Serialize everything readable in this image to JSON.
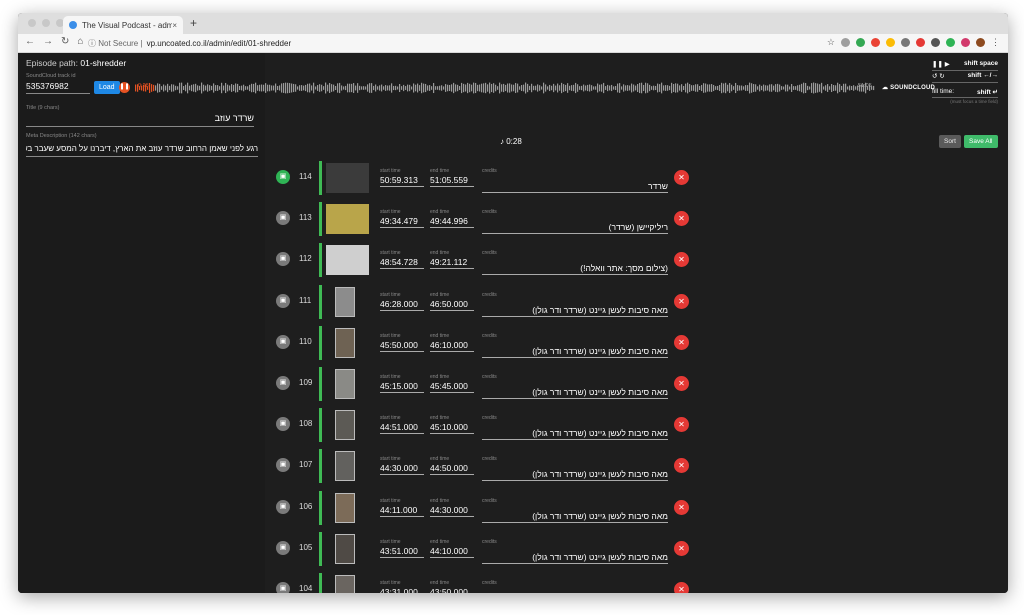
{
  "browser": {
    "tab_title": "The Visual Podcast - admin",
    "url_prefix": "Not Secure",
    "url": "vp.uncoated.co.il/admin/edit/01-shredder"
  },
  "left": {
    "episode_label": "Episode path:",
    "episode_value": "01-shredder",
    "soundcloud_label": "SoundCloud track id",
    "soundcloud_value": "535376982",
    "load_label": "Load",
    "title_label": "Title (9 chars)",
    "title_value": "שרדר עוזב",
    "meta_label": "Meta Description (142 chars)",
    "meta_value": "רגע לפני שאמן הרחוב שרדר עוזב את הארץ, דיברנו על המסע שעבר בשלו..."
  },
  "player": {
    "time_left": "0:28",
    "time_right": "51:05",
    "brand": "SOUNDCLOUD",
    "now_time": "0:28"
  },
  "shortcuts": {
    "play_key": "shift space",
    "seek_key": "shift ←/→",
    "fill_label": "fill time:",
    "fill_key": "shift ↵",
    "hint": "(must focus a time field)"
  },
  "actions": {
    "sort": "Sort",
    "save_all": "Save All"
  },
  "labels": {
    "start": "start time",
    "end": "end time",
    "credits": "credits"
  },
  "rows": [
    {
      "num": "114",
      "start": "50:59.313",
      "end": "51:05.559",
      "credits": "שרדר"
    },
    {
      "num": "113",
      "start": "49:34.479",
      "end": "49:44.996",
      "credits": "ריליקיישן (שרדר)"
    },
    {
      "num": "112",
      "start": "48:54.728",
      "end": "49:21.112",
      "credits": "(צילום מסך: אתר וואלה!)"
    },
    {
      "num": "111",
      "start": "46:28.000",
      "end": "46:50.000",
      "credits": "מאה סיבות לעשן גיינט (שרדר ודר גולן)"
    },
    {
      "num": "110",
      "start": "45:50.000",
      "end": "46:10.000",
      "credits": "מאה סיבות לעשן גיינט (שרדר ודר גולן)"
    },
    {
      "num": "109",
      "start": "45:15.000",
      "end": "45:45.000",
      "credits": "מאה סיבות לעשן גיינט (שרדר ודר גולן)"
    },
    {
      "num": "108",
      "start": "44:51.000",
      "end": "45:10.000",
      "credits": "מאה סיבות לעשן גיינט (שרדר ודר גולן)"
    },
    {
      "num": "107",
      "start": "44:30.000",
      "end": "44:50.000",
      "credits": "מאה סיבות לעשן גיינט (שרדר ודר גולן)"
    },
    {
      "num": "106",
      "start": "44:11.000",
      "end": "44:30.000",
      "credits": "מאה סיבות לעשן גיינט (שרדר ודר גולן)"
    },
    {
      "num": "105",
      "start": "43:51.000",
      "end": "44:10.000",
      "credits": "מאה סיבות לעשן גיינט (שרדר ודר גולן)"
    },
    {
      "num": "104",
      "start": "43:31.000",
      "end": "43:50.000",
      "credits": "מאה סיבות לעשן גיינט (שרדר ודר גולן)"
    }
  ],
  "colors": {
    "accent_green": "#3fbb55",
    "delete_red": "#e53935",
    "soundcloud_orange": "#e65222"
  }
}
